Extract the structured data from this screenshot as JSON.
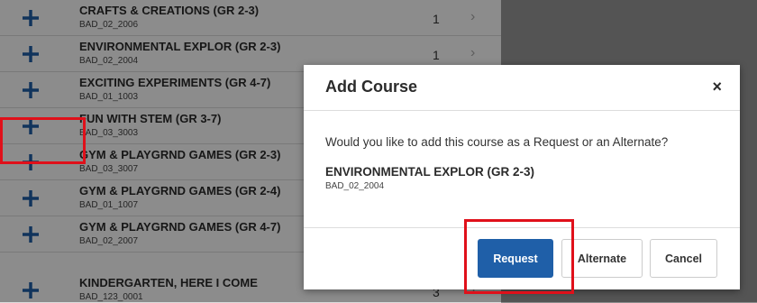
{
  "courses": [
    {
      "title": "CRAFTS & CREATIONS (GR 2-3)",
      "code": "BAD_02_2006",
      "count": "1"
    },
    {
      "title": "ENVIRONMENTAL EXPLOR (GR 2-3)",
      "code": "BAD_02_2004",
      "count": "1"
    },
    {
      "title": "EXCITING EXPERIMENTS (GR 4-7)",
      "code": "BAD_01_1003",
      "count": ""
    },
    {
      "title": "FUN WITH STEM (GR 3-7)",
      "code": "BAD_03_3003",
      "count": ""
    },
    {
      "title": "GYM & PLAYGRND GAMES (GR 2-3)",
      "code": "BAD_03_3007",
      "count": ""
    },
    {
      "title": "GYM & PLAYGRND GAMES (GR 2-4)",
      "code": "BAD_01_1007",
      "count": ""
    },
    {
      "title": "GYM & PLAYGRND GAMES (GR 4-7)",
      "code": "BAD_02_2007",
      "count": ""
    },
    {
      "title": "KINDERGARTEN, HERE I COME",
      "code": "BAD_123_0001",
      "count": "3"
    }
  ],
  "modal": {
    "title": "Add Course",
    "close": "×",
    "question": "Would you like to add this course as a Request or an Alternate?",
    "course_title": "ENVIRONMENTAL EXPLOR (GR 2-3)",
    "course_code": "BAD_02_2004",
    "request_label": "Request",
    "alternate_label": "Alternate",
    "cancel_label": "Cancel"
  },
  "colors": {
    "accent": "#1f5fa8",
    "highlight": "#e0101a"
  },
  "icons": {
    "add": "plus-icon",
    "row_arrow": "chevron-right-icon"
  }
}
